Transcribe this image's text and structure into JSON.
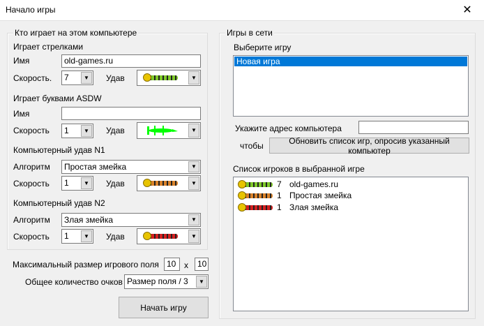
{
  "window": {
    "title": "Начало игры",
    "close_icon": "close-icon"
  },
  "local": {
    "group_title": "Кто играет на этом компьютере",
    "arrows": {
      "heading": "Играет стрелками",
      "name_label": "Имя",
      "name_value": "old-games.ru",
      "speed_label": "Скорость.",
      "speed_value": "7",
      "snake_label": "Удав",
      "snake_color": "#7ec82a"
    },
    "asdw": {
      "heading": "Играет буквами ASDW",
      "name_label": "Имя",
      "name_value": "",
      "speed_label": "Скорость",
      "speed_value": "1",
      "snake_label": "Удав",
      "snake_color": "#00ff00"
    },
    "cpu1": {
      "heading": "Компьютерный удав N1",
      "algo_label": "Алгоритм",
      "algo_value": "Простая змейка",
      "speed_label": "Скорость",
      "speed_value": "1",
      "snake_label": "Удав",
      "snake_color": "#d9822b"
    },
    "cpu2": {
      "heading": "Компьютерный удав N2",
      "algo_label": "Алгоритм",
      "algo_value": "Злая змейка",
      "speed_label": "Скорость",
      "speed_value": "1",
      "snake_label": "Удав",
      "snake_color": "#d42020"
    }
  },
  "field": {
    "label": "Максимальный размер игрового поля",
    "width": "10",
    "x": "x",
    "height": "10"
  },
  "score": {
    "label": "Общее количество очков",
    "value": "Размер поля / 3"
  },
  "start_button": "Начать игру",
  "network": {
    "group_title": "Игры в сети",
    "choose_label": "Выберите игру",
    "games": [
      "Новая игра"
    ],
    "address_label": "Укажите адрес компьютера",
    "address_value": "",
    "so_label": "чтобы",
    "refresh_button": "Обновить список игр, опросив указанный компьютер",
    "players_label": "Список игроков в выбранной игре",
    "players": [
      {
        "speed": "7",
        "name": "old-games.ru",
        "color": "#7ec82a"
      },
      {
        "speed": "1",
        "name": "Простая змейка",
        "color": "#d9822b"
      },
      {
        "speed": "1",
        "name": "Злая змейка",
        "color": "#d42020"
      }
    ]
  }
}
